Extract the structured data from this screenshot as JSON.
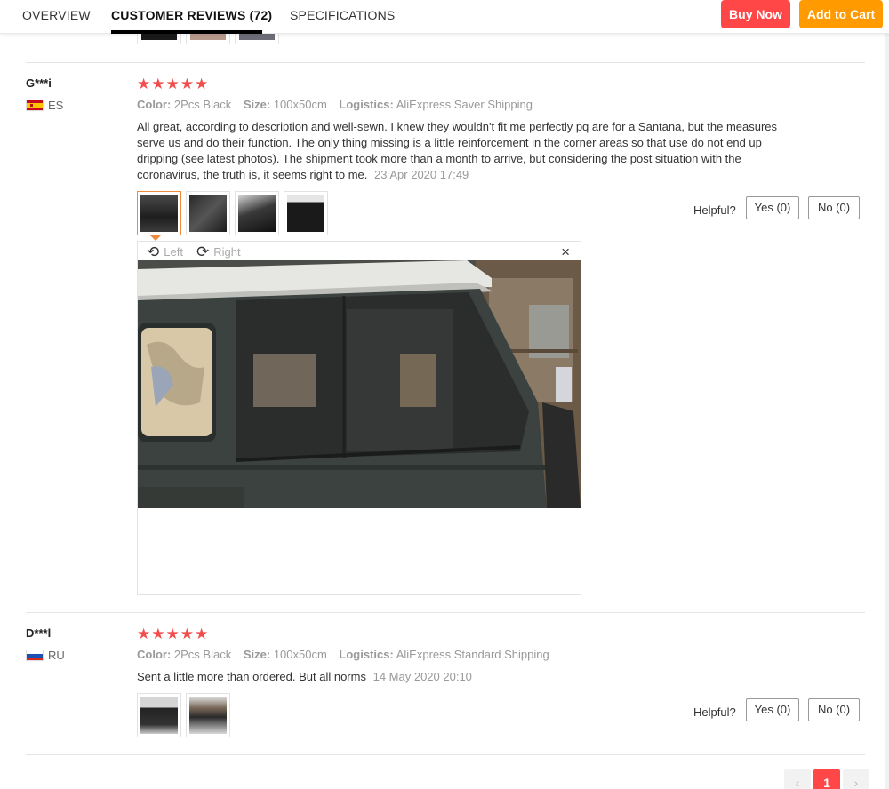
{
  "tabs": [
    {
      "label": "OVERVIEW"
    },
    {
      "label": "CUSTOMER REVIEWS (72)"
    },
    {
      "label": "SPECIFICATIONS"
    }
  ],
  "actions": {
    "buy_now": "Buy Now",
    "add_to_cart": "Add to Cart"
  },
  "labels": {
    "color": "Color:",
    "size": "Size:",
    "logistics": "Logistics:",
    "helpful": "Helpful?",
    "yes": "Yes (0)",
    "no": "No (0)"
  },
  "reviews": [
    {
      "user": "G***i",
      "country": "ES",
      "stars": "★★★★★",
      "color": "2Pcs Black",
      "size": "100x50cm",
      "logistics": "AliExpress Saver Shipping",
      "text": "All great, according to description and well-sewn. I knew they wouldn't fit me perfectly pq are for a Santana, but the measures serve us and do their function. The only thing missing is a little reinforcement in the corner areas so that use do not end up dripping (see latest photos). The shipment took more than a month to arrive, but considering the post situation with the coronavirus, the truth is, it seems right to me.",
      "date": "23 Apr 2020 17:49"
    },
    {
      "user": "D***l",
      "country": "RU",
      "stars": "★★★★★",
      "color": "2Pcs Black",
      "size": "100x50cm",
      "logistics": "AliExpress Standard Shipping",
      "text": "Sent a little more than ordered. But all norms",
      "date": "14 May 2020 20:10"
    }
  ],
  "viewer": {
    "rotate_left": "Left",
    "rotate_right": "Right",
    "close": "×"
  },
  "pagination": {
    "prev": "‹",
    "current": "1",
    "next": "›"
  },
  "colors": {
    "accent_red": "#ff4747",
    "accent_orange": "#ff9a00",
    "star": "#f24d4d"
  }
}
